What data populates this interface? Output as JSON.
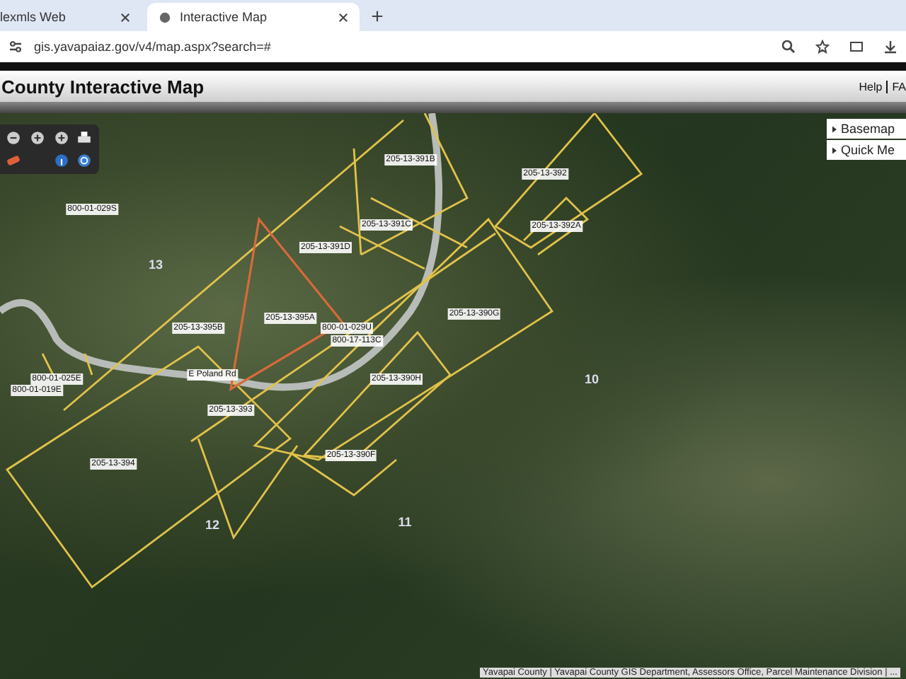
{
  "tabs": [
    {
      "label": "lexmls Web",
      "selected": false
    },
    {
      "label": "Interactive Map",
      "selected": true
    }
  ],
  "address_bar": {
    "url": "gis.yavapaiaz.gov/v4/map.aspx?search=#"
  },
  "header": {
    "title": "County Interactive Map",
    "links": [
      "Help",
      "FA"
    ]
  },
  "map": {
    "parcel_labels": [
      "800-01-029S",
      "205-13-391B",
      "205-13-391C",
      "205-13-391D",
      "205-13-395B",
      "205-13-395A",
      "800-01-029U",
      "800-17-113C",
      "800-01-025E",
      "800-01-019E",
      "205-13-393",
      "205-13-394",
      "205-13-392",
      "205-13-392A",
      "205-13-390G",
      "205-13-390H",
      "205-13-390F"
    ],
    "road_labels": [
      "E Poland Rd"
    ],
    "section_numbers": [
      "13",
      "10",
      "12",
      "11"
    ],
    "panels": [
      "Basemap",
      "Quick Me"
    ],
    "attribution": "Yavapai County | Yavapai County GIS Department, Assessors Office, Parcel Maintenance Division | ..."
  }
}
